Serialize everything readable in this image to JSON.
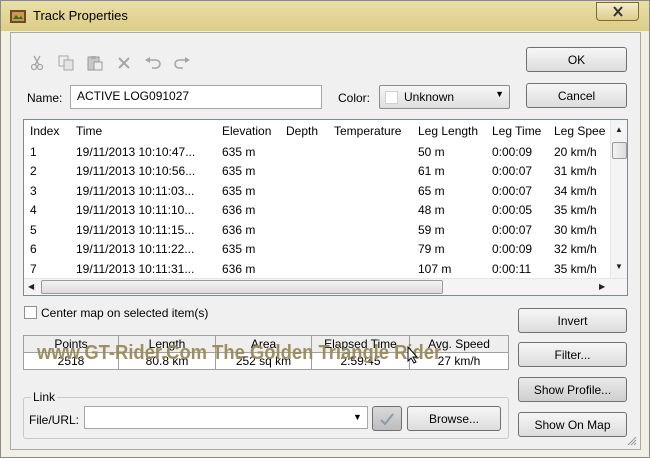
{
  "window": {
    "title": "Track Properties",
    "icons": {
      "title": "track-app-icon",
      "close": "close-icon"
    }
  },
  "toolbar": {
    "icons": [
      "scissors-icon",
      "copy-icon",
      "paste-icon",
      "delete-x-icon",
      "undo-icon",
      "redo-icon"
    ]
  },
  "buttons": {
    "ok": "OK",
    "cancel": "Cancel",
    "invert": "Invert",
    "filter": "Filter...",
    "show_profile": "Show Profile...",
    "show_on_map": "Show On Map",
    "browse": "Browse..."
  },
  "name_field": {
    "label": "Name:",
    "value": "ACTIVE LOG091027"
  },
  "color_field": {
    "label": "Color:",
    "value": "Unknown"
  },
  "table": {
    "columns": [
      "Index",
      "Time",
      "Elevation",
      "Depth",
      "Temperature",
      "Leg Length",
      "Leg Time",
      "Leg Spee"
    ],
    "rows": [
      [
        "1",
        "19/11/2013 10:10:47...",
        "635 m",
        "",
        "",
        "50 m",
        "0:00:09",
        "20 km/h"
      ],
      [
        "2",
        "19/11/2013 10:10:56...",
        "635 m",
        "",
        "",
        "61 m",
        "0:00:07",
        "31 km/h"
      ],
      [
        "3",
        "19/11/2013 10:11:03...",
        "635 m",
        "",
        "",
        "65 m",
        "0:00:07",
        "34 km/h"
      ],
      [
        "4",
        "19/11/2013 10:11:10...",
        "636 m",
        "",
        "",
        "48 m",
        "0:00:05",
        "35 km/h"
      ],
      [
        "5",
        "19/11/2013 10:11:15...",
        "636 m",
        "",
        "",
        "59 m",
        "0:00:07",
        "30 km/h"
      ],
      [
        "6",
        "19/11/2013 10:11:22...",
        "635 m",
        "",
        "",
        "79 m",
        "0:00:09",
        "32 km/h"
      ],
      [
        "7",
        "19/11/2013 10:11:31...",
        "636 m",
        "",
        "",
        "107 m",
        "0:00:11",
        "35 km/h"
      ]
    ]
  },
  "center_map": {
    "label": "Center map on selected item(s)",
    "checked": false
  },
  "stats": {
    "headers": [
      "Points",
      "Length",
      "Area",
      "Elapsed Time",
      "Avg. Speed"
    ],
    "values": [
      "2518",
      "80.8 km",
      "252 sq km",
      "2:59:45",
      "27 km/h"
    ]
  },
  "link": {
    "group_label": "Link",
    "file_label": "File/URL:",
    "file_value": "",
    "go_icon": "link-go-icon"
  },
  "watermark": "www.GT-Rider.Com   The Golden Triangle Rider"
}
